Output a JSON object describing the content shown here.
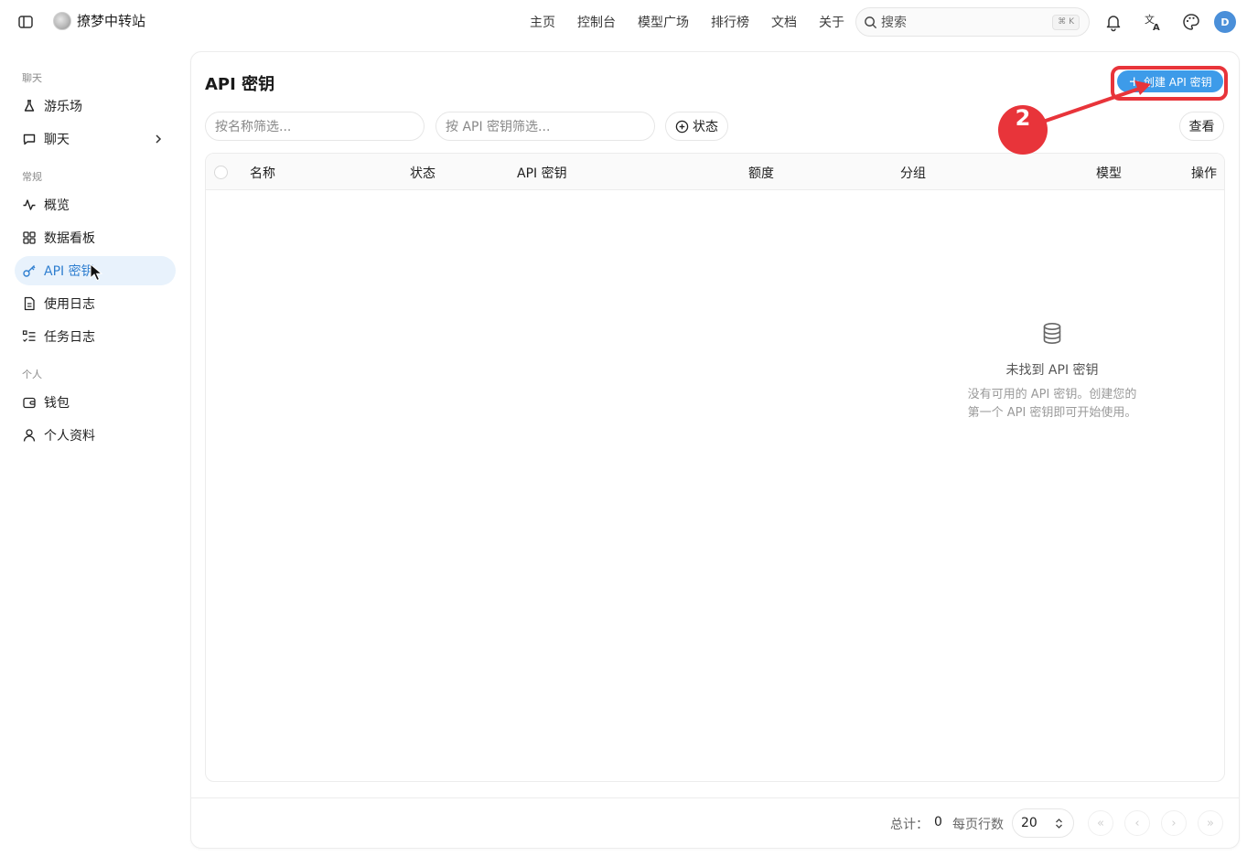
{
  "topbar": {
    "brand_name": "撩梦中转站",
    "nav": [
      "主页",
      "控制台",
      "模型广场",
      "排行榜",
      "文档",
      "关于"
    ],
    "search_placeholder": "搜索",
    "search_shortcut": "⌘ K",
    "avatar_letter": "D"
  },
  "sidebar": {
    "groups": {
      "chat": "聊天",
      "general": "常规",
      "personal": "个人"
    },
    "items": [
      {
        "label": "游乐场",
        "icon": "flask-icon"
      },
      {
        "label": "聊天",
        "icon": "message-icon"
      },
      {
        "label": "概览",
        "icon": "activity-icon"
      },
      {
        "label": "数据看板",
        "icon": "dashboard-icon"
      },
      {
        "label": "API 密钥",
        "icon": "key-icon",
        "active": true
      },
      {
        "label": "使用日志",
        "icon": "log-icon"
      },
      {
        "label": "任务日志",
        "icon": "list-icon"
      },
      {
        "label": "钱包",
        "icon": "wallet-icon"
      },
      {
        "label": "个人资料",
        "icon": "user-icon"
      }
    ]
  },
  "main": {
    "title": "API 密钥",
    "create_button": "创建 API 密钥",
    "filter_name_placeholder": "按名称筛选...",
    "filter_key_placeholder": "按 API 密钥筛选...",
    "status_filter": "状态",
    "view_button": "查看",
    "columns": [
      "名称",
      "状态",
      "API 密钥",
      "额度",
      "分组",
      "模型",
      "操作"
    ],
    "empty_title": "未找到 API 密钥",
    "empty_desc_line1": "没有可用的 API 密钥。创建您的",
    "empty_desc_line2": "第一个 API 密钥即可开始使用。"
  },
  "pagination": {
    "total_label": "总计：",
    "total_value": "0",
    "rows_label": "每页行数",
    "rows_value": "20"
  },
  "annotation": {
    "step_number": "2",
    "color": "#e8343a"
  },
  "colors": {
    "accent": "#3d9be9",
    "active_bg": "#e8f2fc",
    "active_text": "#2f7fd0"
  }
}
